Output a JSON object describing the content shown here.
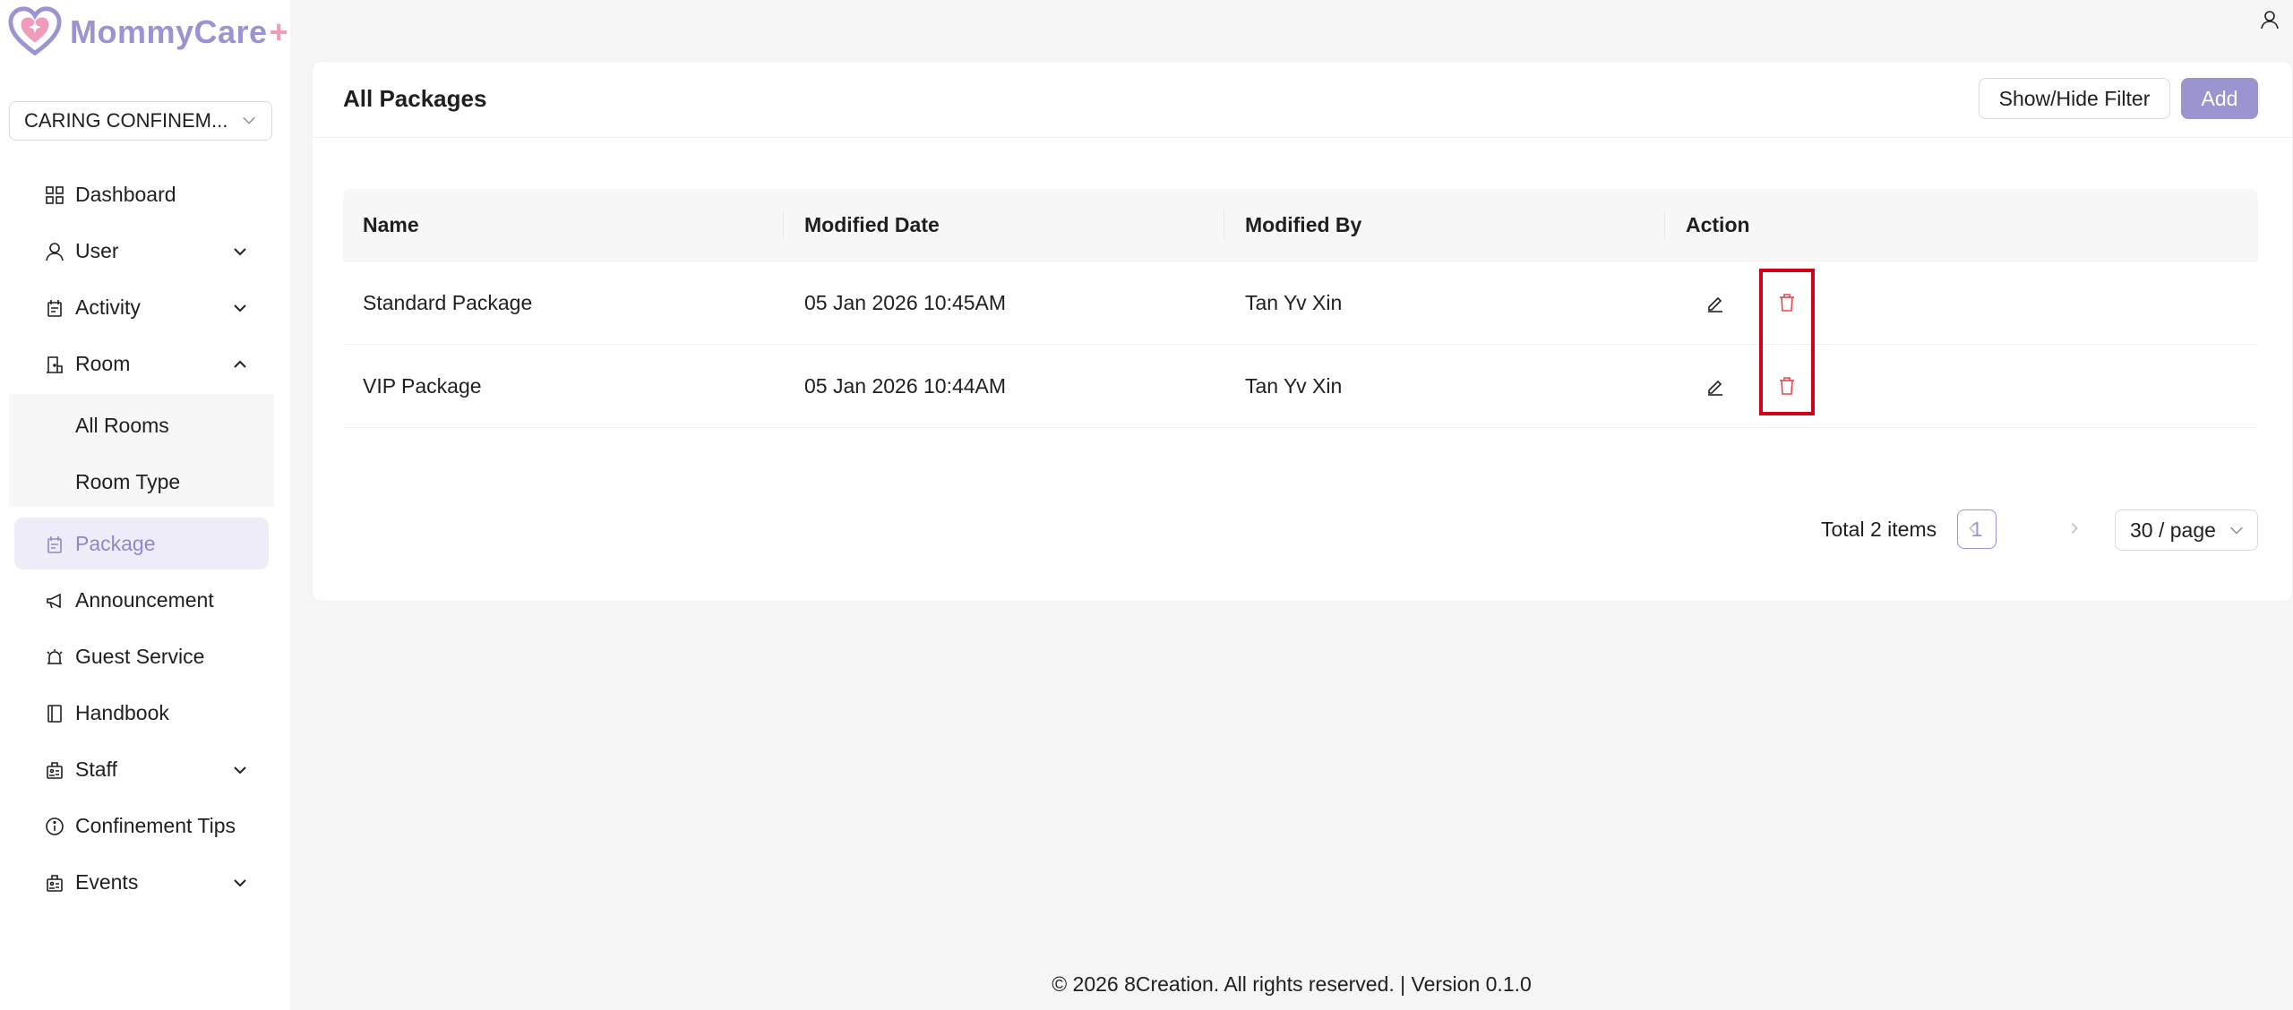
{
  "brand": {
    "name": "MommyCare",
    "plus": "+",
    "colors": {
      "accent": "#9a94d0",
      "pink": "#ef9bb9",
      "danger": "#d0021b"
    }
  },
  "org_selector": {
    "value": "CARING CONFINEM..."
  },
  "sidebar": {
    "items": [
      {
        "label": "Dashboard",
        "icon": "dashboard-icon"
      },
      {
        "label": "User",
        "icon": "user-icon",
        "chevron": "down"
      },
      {
        "label": "Activity",
        "icon": "activity-icon",
        "chevron": "down"
      },
      {
        "label": "Room",
        "icon": "room-icon",
        "chevron": "up"
      },
      {
        "label": "Package",
        "icon": "package-icon",
        "active": true
      },
      {
        "label": "Announcement",
        "icon": "megaphone-icon"
      },
      {
        "label": "Guest Service",
        "icon": "bell-icon"
      },
      {
        "label": "Handbook",
        "icon": "book-icon"
      },
      {
        "label": "Staff",
        "icon": "staff-icon",
        "chevron": "down"
      },
      {
        "label": "Confinement Tips",
        "icon": "info-icon"
      },
      {
        "label": "Events",
        "icon": "events-icon",
        "chevron": "down"
      }
    ],
    "room_submenu": [
      {
        "label": "All Rooms"
      },
      {
        "label": "Room Type"
      }
    ]
  },
  "page": {
    "title": "All Packages",
    "filter_button": "Show/Hide Filter",
    "add_button": "Add"
  },
  "table": {
    "columns": [
      "Name",
      "Modified Date",
      "Modified By",
      "Action"
    ],
    "rows": [
      {
        "name": "Standard Package",
        "modified_date": "05 Jan 2026 10:45AM",
        "modified_by": "Tan Yv Xin"
      },
      {
        "name": "VIP Package",
        "modified_date": "05 Jan 2026 10:44AM",
        "modified_by": "Tan Yv Xin"
      }
    ]
  },
  "pagination": {
    "total": "Total 2 items",
    "current_page": "1",
    "page_size": "30 / page"
  },
  "footer": {
    "text": "© 2026 8Creation. All rights reserved. | Version 0.1.0"
  }
}
